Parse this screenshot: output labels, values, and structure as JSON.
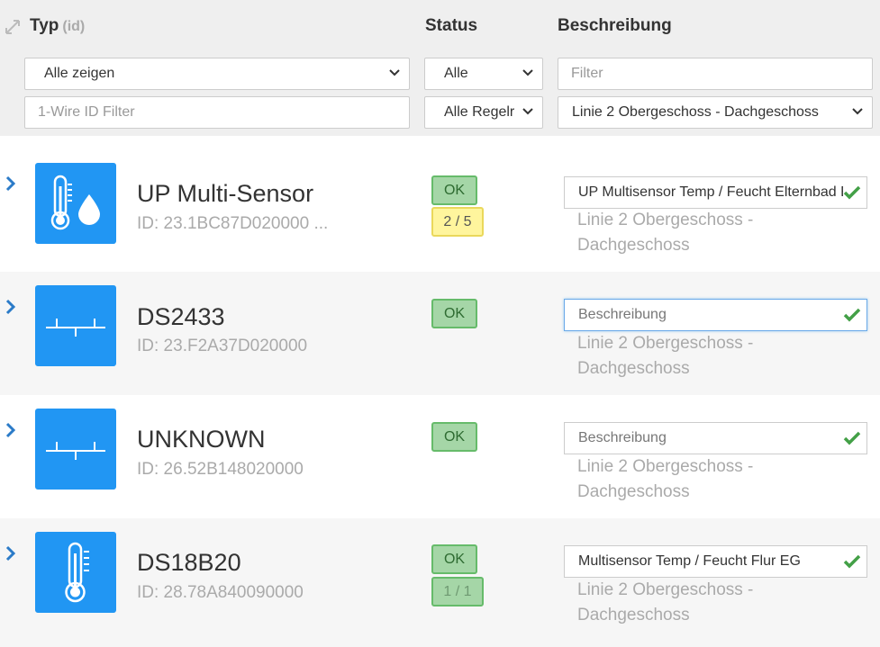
{
  "header": {
    "typ_label": "Typ",
    "typ_sub": "(id)",
    "status_label": "Status",
    "desc_label": "Beschreibung"
  },
  "filters": {
    "type_select": "Alle zeigen",
    "status_select": "Alle",
    "desc_placeholder": "Filter",
    "id_placeholder": "1-Wire ID Filter",
    "regel_select": "Alle Regelr",
    "location_select": "Linie 2 Obergeschoss - Dachgeschoss"
  },
  "devices": [
    {
      "name": "UP Multi-Sensor",
      "id": "ID: 23.1BC87D020000 ...",
      "icon": "thermometer-drop-icon",
      "status": "OK",
      "count": "2 / 5",
      "description": "UP Multisensor Temp / Feucht Elternbad EG",
      "location": "Linie 2 Obergeschoss - Dachgeschoss"
    },
    {
      "name": "DS2433",
      "id": "ID: 23.F2A37D020000",
      "icon": "bus-connector-icon",
      "status": "OK",
      "description_placeholder": "Beschreibung",
      "location": "Linie 2 Obergeschoss - Dachgeschoss"
    },
    {
      "name": "UNKNOWN",
      "id": "ID: 26.52B148020000",
      "icon": "bus-connector-icon",
      "status": "OK",
      "description_placeholder": "Beschreibung",
      "location": "Linie 2 Obergeschoss - Dachgeschoss"
    },
    {
      "name": "DS18B20",
      "id": "ID: 28.78A840090000",
      "icon": "thermometer-icon",
      "status": "OK",
      "count": "1 / 1",
      "description": "Multisensor Temp / Feucht Flur EG",
      "location": "Linie 2 Obergeschoss - Dachgeschoss"
    }
  ],
  "colors": {
    "tile": "#2196f3",
    "ok_bg": "#a5d6a7",
    "warn_bg": "#fff59d",
    "check": "#43a047",
    "chevron": "#2b7bc8"
  }
}
